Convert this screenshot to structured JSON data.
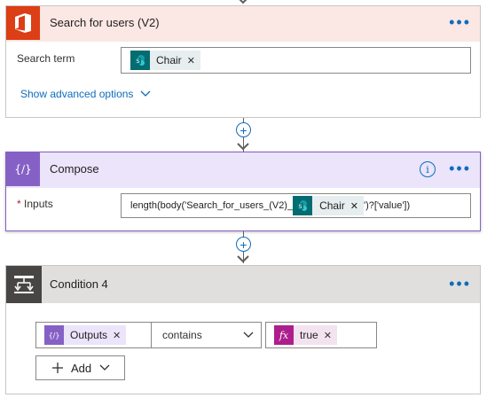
{
  "search_card": {
    "title": "Search for users (V2)",
    "more": "•••",
    "field_label": "Search term",
    "token_label": "Chair",
    "token_remove": "✕",
    "advanced_link": "Show advanced options",
    "colors": {
      "header_bg": "#fbe7e3",
      "icon_bg": "#dc3e15"
    }
  },
  "compose_card": {
    "title": "Compose",
    "more": "•••",
    "info": "i",
    "required_mark": "*",
    "field_label": "Inputs",
    "expr_prefix": "length(body('Search_for_users_(V2)_",
    "token_label": "Chair",
    "token_remove": "✕",
    "expr_suffix": "')?['value'])",
    "colors": {
      "header_bg": "#ebe4fb",
      "icon_bg": "#8661c5",
      "border": "#8661c5"
    }
  },
  "condition_card": {
    "title": "Condition 4",
    "more": "•••",
    "left_token_label": "Outputs",
    "left_token_remove": "✕",
    "operator": "contains",
    "right_token_label": "true",
    "right_token_remove": "✕",
    "add_label": "Add",
    "colors": {
      "header_bg": "#e1dfdd",
      "icon_bg": "#484644"
    }
  },
  "connectors": {
    "plus_symbol": "+"
  },
  "icons": {
    "office": "office-icon",
    "sharepoint": "sharepoint-icon",
    "compose": "compose-icon",
    "condition": "condition-icon",
    "expression": "fx-icon"
  }
}
